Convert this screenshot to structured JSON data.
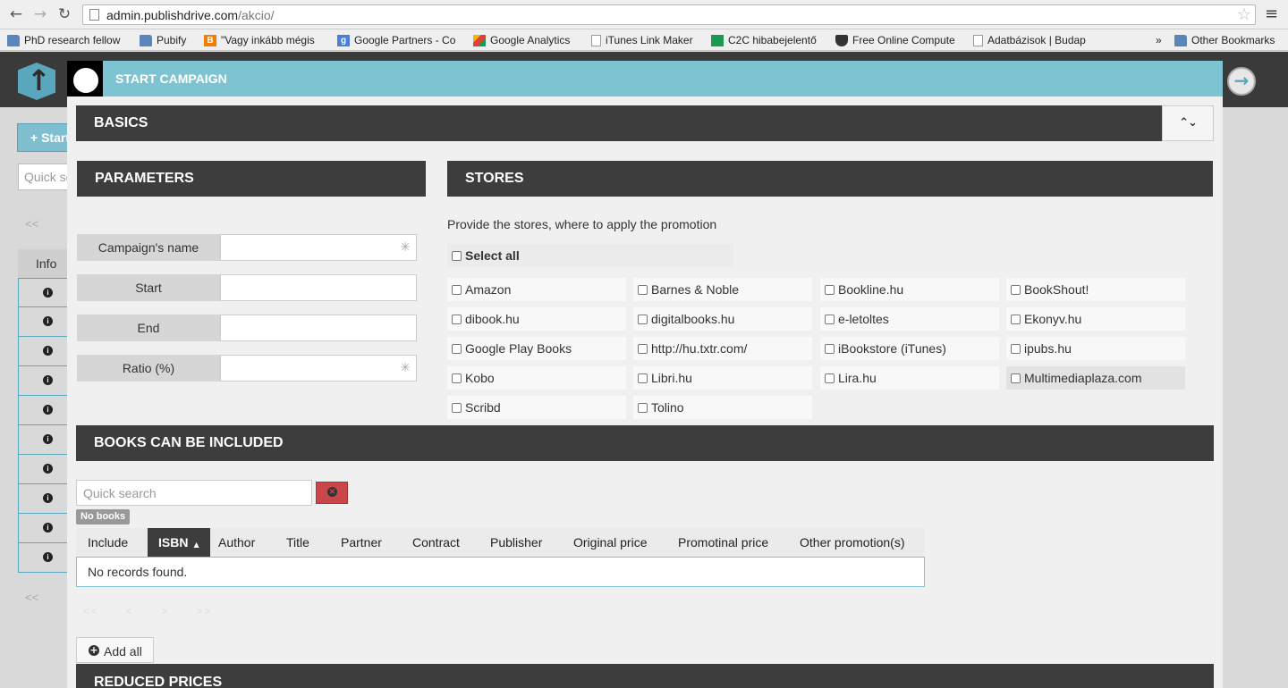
{
  "browser": {
    "url_host": "admin.publishdrive.com",
    "url_path": "/akcio/",
    "bookmarks": [
      {
        "label": "PhD research fellow",
        "icon": "folder-icon"
      },
      {
        "label": "Pubify",
        "icon": "folder-icon"
      },
      {
        "label": "\"Vagy inkább mégis",
        "icon": "blogger-icon"
      },
      {
        "label": "Google Partners - Co",
        "icon": "google-icon"
      },
      {
        "label": "Google Analytics",
        "icon": "analytics-icon"
      },
      {
        "label": "iTunes Link Maker",
        "icon": "page-icon"
      },
      {
        "label": "C2C hibabejelentő",
        "icon": "sheet-icon"
      },
      {
        "label": "Free Online Compute",
        "icon": "shield-icon"
      },
      {
        "label": "Adatbázisok | Budap",
        "icon": "page-icon"
      },
      {
        "label": "»",
        "icon": ""
      },
      {
        "label": "Other Bookmarks",
        "icon": "folder-icon"
      }
    ]
  },
  "background": {
    "add_button": "+ Start",
    "search_placeholder": "Quick search",
    "pager": "<<",
    "info_header": "Info",
    "row_count": 10
  },
  "modal": {
    "title": "START CAMPAIGN",
    "basics": "BASICS",
    "collapse": "⌃⌄",
    "parameters": {
      "heading": "PARAMETERS",
      "fields": [
        {
          "label": "Campaign's name",
          "value": "",
          "required": "✳"
        },
        {
          "label": "Start",
          "value": "",
          "required": ""
        },
        {
          "label": "End",
          "value": "",
          "required": ""
        },
        {
          "label": "Ratio (%)",
          "value": "",
          "required": "✳"
        }
      ]
    },
    "stores": {
      "heading": "STORES",
      "hint": "Provide the stores, where to apply the promotion",
      "select_all": "Select all",
      "items": [
        "Amazon",
        "Barnes & Noble",
        "Bookline.hu",
        "BookShout!",
        "dibook.hu",
        "digitalbooks.hu",
        "e-letoltes",
        "Ekonyv.hu",
        "Google Play Books",
        "http://hu.txtr.com/",
        "iBookstore (iTunes)",
        "ipubs.hu",
        "Kobo",
        "Libri.hu",
        "Lira.hu",
        "Multimediaplaza.com",
        "Scribd",
        "Tolino"
      ]
    },
    "books": {
      "heading": "BOOKS CAN BE INCLUDED",
      "search_placeholder": "Quick search",
      "badge": "No books",
      "columns": [
        "Include",
        "ISBN",
        "Author",
        "Title",
        "Partner",
        "Contract",
        "Publisher",
        "Original price",
        "Promotinal price",
        "Other promotion(s)"
      ],
      "sort_indicator": "▲",
      "empty": "No records found.",
      "pager": [
        "<<",
        "<",
        ">",
        ">>"
      ],
      "add_all": "Add all"
    },
    "reduced_prices": "REDUCED PRICES"
  },
  "colors": {
    "accent": "#7ec3d2",
    "dark": "#3d3d3d",
    "danger": "#c9464a"
  }
}
